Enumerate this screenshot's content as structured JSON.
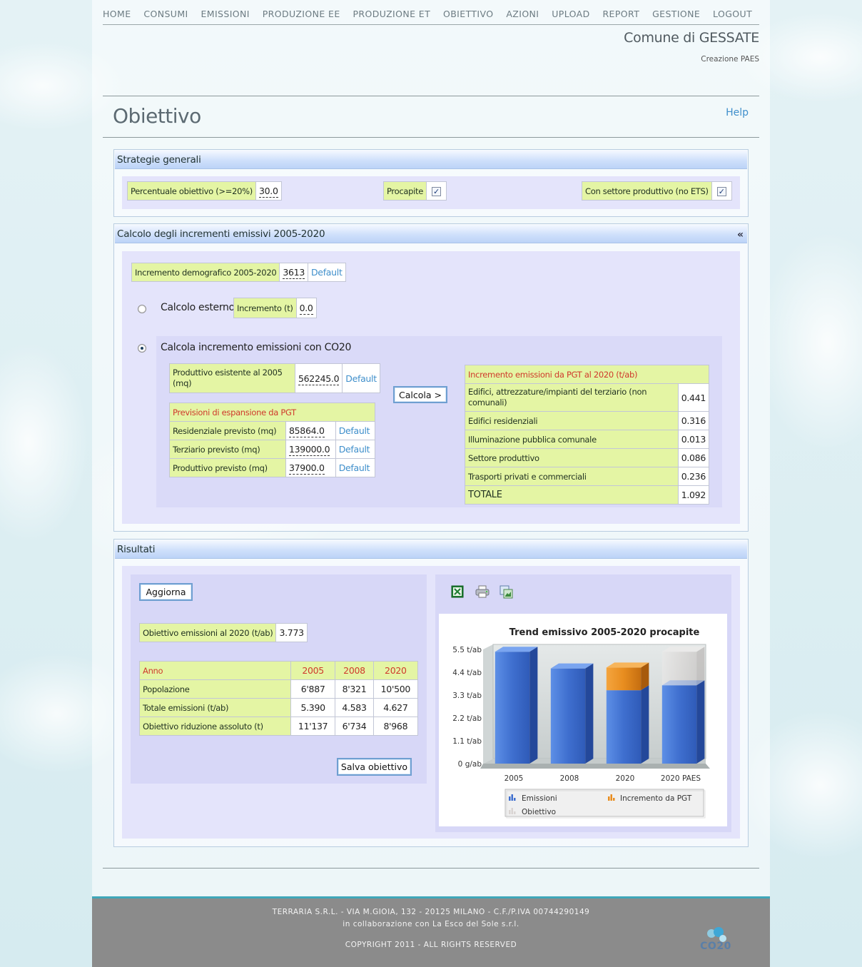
{
  "nav": {
    "items": [
      "HOME",
      "CONSUMI",
      "EMISSIONI",
      "PRODUZIONE EE",
      "PRODUZIONE ET",
      "OBIETTIVO",
      "AZIONI",
      "UPLOAD",
      "REPORT",
      "GESTIONE",
      "LOGOUT"
    ]
  },
  "header": {
    "comune": "Comune di GESSATE",
    "subtitle": "Creazione PAES",
    "page_title": "Obiettivo",
    "help": "Help"
  },
  "strategie": {
    "title": "Strategie generali",
    "percentuale_label": "Percentuale obiettivo (>=20%)",
    "percentuale_value": "30.0",
    "procapite_label": "Procapite",
    "procapite_checked": true,
    "settore_label": "Con settore produttivo (no ETS)",
    "settore_checked": true,
    "check_glyph": "✓"
  },
  "calcolo": {
    "title": "Calcolo degli incrementi emissivi 2005-2020",
    "collapse_glyph": "«",
    "incremento_demografico_label": "Incremento demografico 2005-2020",
    "incremento_demografico_value": "3613",
    "default_label": "Default",
    "calcolo_esterno_label": "Calcolo esterno",
    "incremento_t_label": "Incremento (t)",
    "incremento_t_value": "0.0",
    "calcola_co20_label": "Calcola incremento emissioni con CO20",
    "produttivo_label": "Produttivo esistente al 2005 (mq)",
    "produttivo_value": "562245.0",
    "previsioni_title": "Previsioni di espansione da PGT",
    "previsioni": [
      {
        "label": "Residenziale previsto (mq)",
        "value": "85864.0"
      },
      {
        "label": "Terziario previsto (mq)",
        "value": "139000.0"
      },
      {
        "label": "Produttivo previsto (mq)",
        "value": "37900.0"
      }
    ],
    "calcola_button": "Calcola >",
    "incremento_pgt_title": "Incremento emissioni da PGT al 2020 (t/ab)",
    "incremento_pgt": [
      {
        "label": "Edifici, attrezzature/impianti del terziario (non comunali)",
        "value": "0.441"
      },
      {
        "label": "Edifici residenziali",
        "value": "0.316"
      },
      {
        "label": "Illuminazione pubblica comunale",
        "value": "0.013"
      },
      {
        "label": "Settore produttivo",
        "value": "0.086"
      },
      {
        "label": "Trasporti privati e commerciali",
        "value": "0.236"
      },
      {
        "label": "TOTALE",
        "value": "1.092"
      }
    ]
  },
  "risultati": {
    "title": "Risultati",
    "aggiorna_button": "Aggiorna",
    "obiettivo_label": "Obiettivo emissioni al 2020 (t/ab)",
    "obiettivo_value": "3.773",
    "table": {
      "headers": [
        "Anno",
        "2005",
        "2008",
        "2020"
      ],
      "rows": [
        [
          "Popolazione",
          "6'887",
          "8'321",
          "10'500"
        ],
        [
          "Totale emissioni (t/ab)",
          "5.390",
          "4.583",
          "4.627"
        ],
        [
          "Obiettivo riduzione assoluto (t)",
          "11'137",
          "6'734",
          "8'968"
        ]
      ]
    },
    "salva_button": "Salva obiettivo",
    "toolbar_icons": [
      "excel-export-icon",
      "print-icon",
      "export-image-icon"
    ]
  },
  "chart_data": {
    "type": "bar",
    "title": "Trend emissivo 2005-2020 procapite",
    "categories": [
      "2005",
      "2008",
      "2020",
      "2020 PAES"
    ],
    "y_tick_labels": [
      "0 g/ab",
      "1.1 t/ab",
      "2.2 t/ab",
      "3.3 t/ab",
      "4.4 t/ab",
      "5.5 t/ab"
    ],
    "y_ticks": [
      0,
      1.1,
      2.2,
      3.3,
      4.4,
      5.5
    ],
    "ylim": [
      0,
      5.5
    ],
    "series": [
      {
        "name": "Emissioni",
        "values": [
          5.39,
          4.583,
          3.535,
          3.773
        ],
        "color": "#3f6fcf"
      },
      {
        "name": "Incremento da PGT",
        "values": [
          0,
          0,
          1.092,
          0
        ],
        "color": "#e88d1f"
      },
      {
        "name": "Obiettivo",
        "values": [
          0,
          0,
          0,
          1.617
        ],
        "color": "#d9d4d2"
      }
    ],
    "stacked": true,
    "legend_position": "bottom",
    "grid": false
  },
  "footer": {
    "line1": "TERRARIA S.R.L. - VIA M.GIOIA, 132 - 20125 MILANO - C.F./P.IVA 00744290149",
    "line2": "in collaborazione con La Esco del Sole s.r.l.",
    "copyright": "COPYRIGHT 2011 - ALL RIGHTS RESERVED",
    "logo": "CO20"
  }
}
